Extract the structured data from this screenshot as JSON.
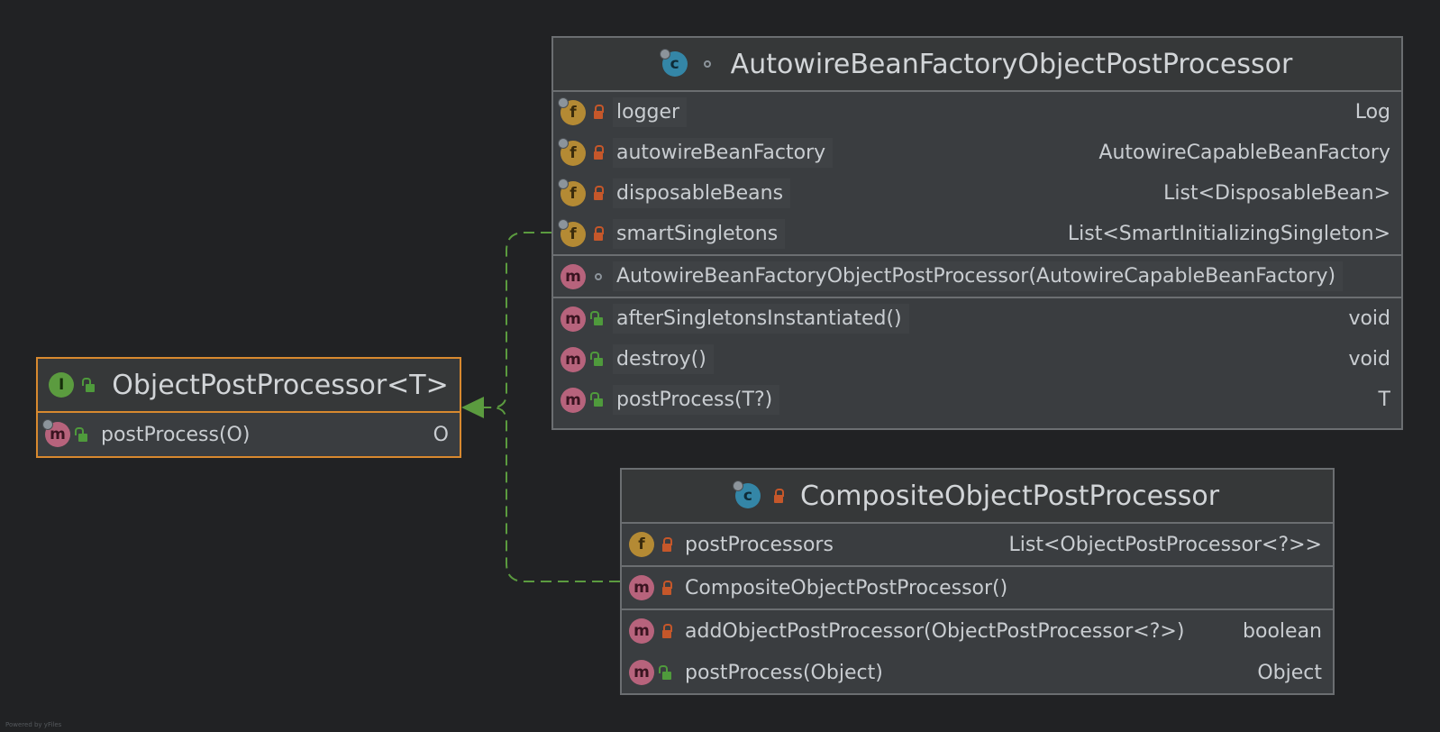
{
  "colors": {
    "background": "#212224",
    "selected_border": "#d8892f",
    "edge": "#5b9b3f"
  },
  "classes": {
    "autowire": {
      "title": "AutowireBeanFactoryObjectPostProcessor",
      "icon": "class-icon",
      "visibility": "package-private",
      "fields": [
        {
          "name": "logger",
          "type": "Log",
          "icon": "field-icon",
          "visibility": "private"
        },
        {
          "name": "autowireBeanFactory",
          "type": "AutowireCapableBeanFactory",
          "icon": "field-icon",
          "visibility": "private"
        },
        {
          "name": "disposableBeans",
          "type": "List<DisposableBean>",
          "icon": "field-icon",
          "visibility": "private"
        },
        {
          "name": "smartSingletons",
          "type": "List<SmartInitializingSingleton>",
          "icon": "field-icon",
          "visibility": "private"
        }
      ],
      "constructors": [
        {
          "name": "AutowireBeanFactoryObjectPostProcessor(AutowireCapableBeanFactory)",
          "type": "",
          "icon": "method-icon",
          "visibility": "package-private"
        }
      ],
      "methods": [
        {
          "name": "afterSingletonsInstantiated()",
          "type": "void",
          "icon": "method-icon",
          "visibility": "public"
        },
        {
          "name": "destroy()",
          "type": "void",
          "icon": "method-icon",
          "visibility": "public"
        },
        {
          "name": "postProcess(T?)",
          "type": "T",
          "icon": "method-icon",
          "visibility": "public"
        }
      ]
    },
    "object_post_processor": {
      "title": "ObjectPostProcessor<T>",
      "icon": "interface-icon",
      "visibility": "public",
      "methods": [
        {
          "name": "postProcess(O)",
          "type": "O",
          "icon": "method-icon",
          "visibility": "public"
        }
      ]
    },
    "composite": {
      "title": "CompositeObjectPostProcessor",
      "icon": "class-icon",
      "visibility": "private",
      "fields": [
        {
          "name": "postProcessors",
          "type": "List<ObjectPostProcessor<?>>",
          "icon": "field-icon",
          "visibility": "private"
        }
      ],
      "constructors": [
        {
          "name": "CompositeObjectPostProcessor()",
          "type": "",
          "icon": "method-icon",
          "visibility": "private"
        }
      ],
      "methods": [
        {
          "name": "addObjectPostProcessor(ObjectPostProcessor<?>)",
          "type": "boolean",
          "icon": "method-icon",
          "visibility": "private"
        },
        {
          "name": "postProcess(Object)",
          "type": "Object",
          "icon": "method-icon",
          "visibility": "public"
        }
      ]
    }
  },
  "footer": "Powered by yFiles"
}
